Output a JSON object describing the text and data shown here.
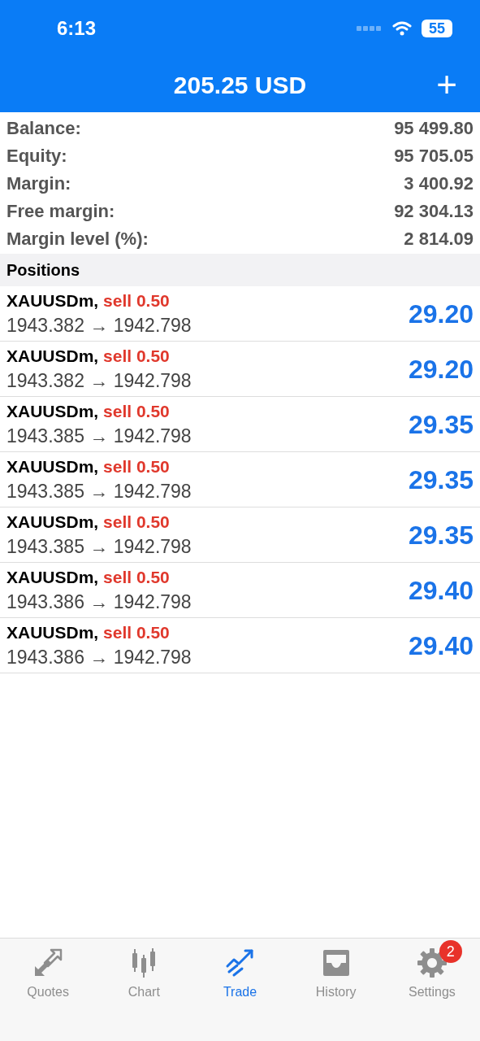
{
  "status_bar": {
    "time": "6:13",
    "battery": "55"
  },
  "header": {
    "title": "205.25 USD",
    "add_button": "+"
  },
  "summary": [
    {
      "label": "Balance:",
      "value": "95 499.80"
    },
    {
      "label": "Equity:",
      "value": "95 705.05"
    },
    {
      "label": "Margin:",
      "value": "3 400.92"
    },
    {
      "label": "Free margin:",
      "value": "92 304.13"
    },
    {
      "label": "Margin level (%):",
      "value": "2 814.09"
    }
  ],
  "positions_heading": "Positions",
  "positions": [
    {
      "symbol": "XAUUSDm,",
      "side": "sell 0.50",
      "prices": "1943.382 → 1942.798",
      "profit": "29.20"
    },
    {
      "symbol": "XAUUSDm,",
      "side": "sell 0.50",
      "prices": "1943.382 → 1942.798",
      "profit": "29.20"
    },
    {
      "symbol": "XAUUSDm,",
      "side": "sell 0.50",
      "prices": "1943.385 → 1942.798",
      "profit": "29.35"
    },
    {
      "symbol": "XAUUSDm,",
      "side": "sell 0.50",
      "prices": "1943.385 → 1942.798",
      "profit": "29.35"
    },
    {
      "symbol": "XAUUSDm,",
      "side": "sell 0.50",
      "prices": "1943.385 → 1942.798",
      "profit": "29.35"
    },
    {
      "symbol": "XAUUSDm,",
      "side": "sell 0.50",
      "prices": "1943.386 → 1942.798",
      "profit": "29.40"
    },
    {
      "symbol": "XAUUSDm,",
      "side": "sell 0.50",
      "prices": "1943.386 → 1942.798",
      "profit": "29.40"
    }
  ],
  "tabs": [
    {
      "label": "Quotes",
      "selected": false
    },
    {
      "label": "Chart",
      "selected": false
    },
    {
      "label": "Trade",
      "selected": true
    },
    {
      "label": "History",
      "selected": false
    },
    {
      "label": "Settings",
      "selected": false,
      "badge": "2"
    }
  ]
}
